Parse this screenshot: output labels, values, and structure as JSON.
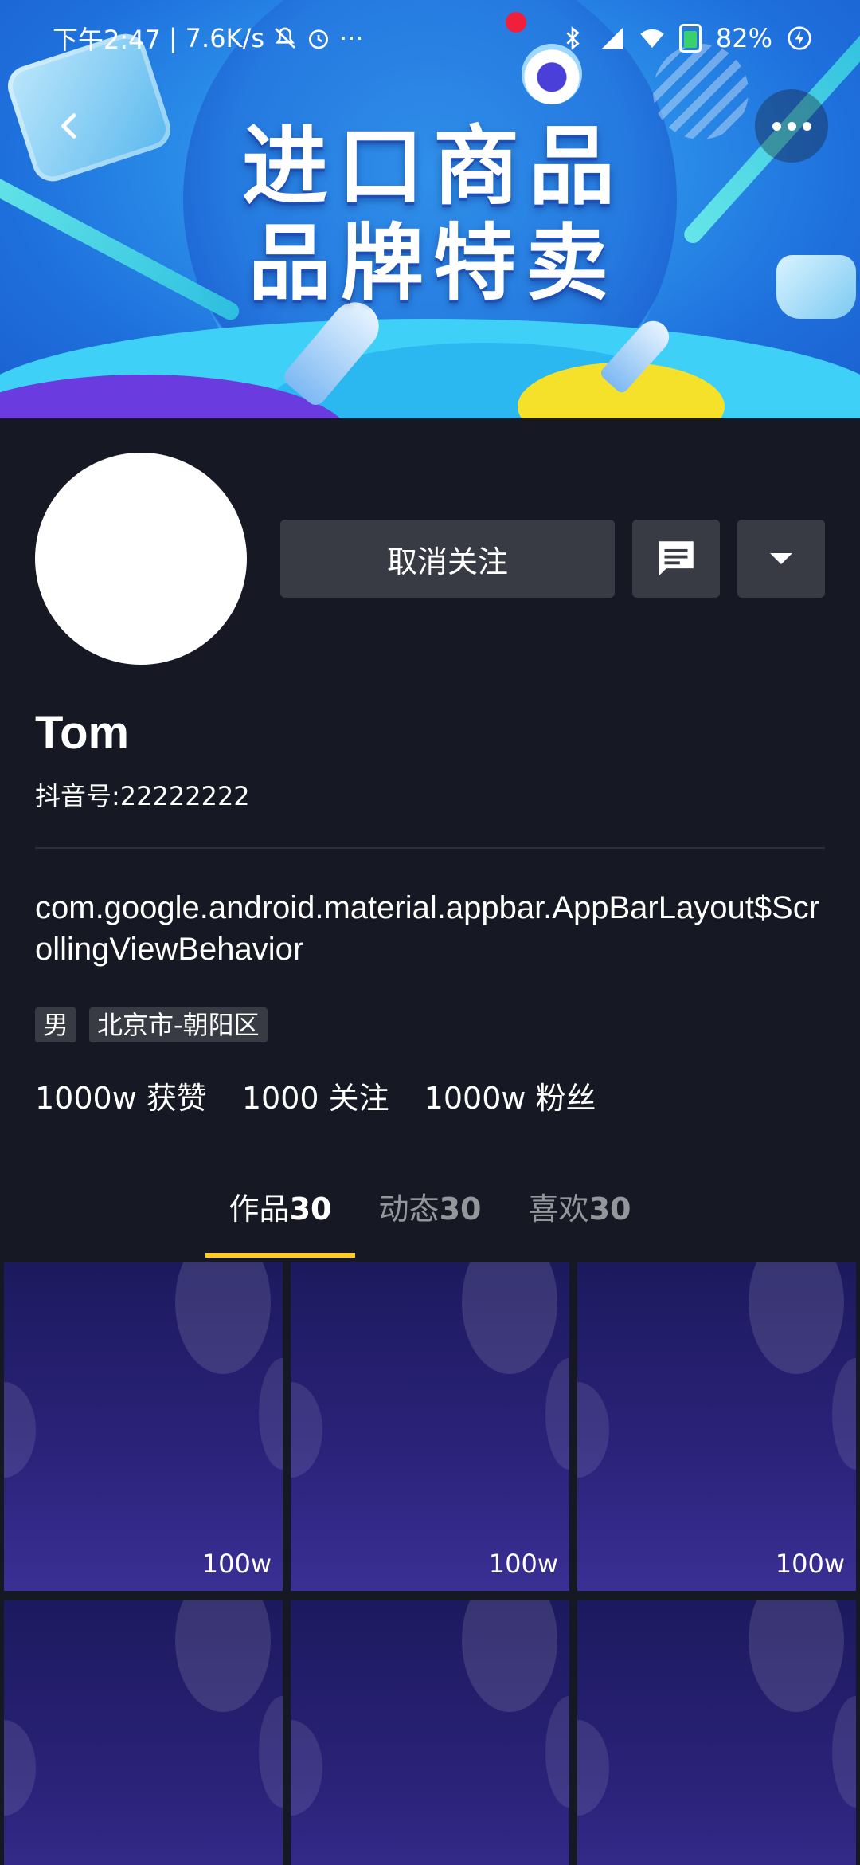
{
  "status_bar": {
    "time": "下午2:47",
    "network_speed": "7.6K/s",
    "battery": "82%"
  },
  "banner": {
    "line1": "进口商品",
    "line2": "品牌特卖"
  },
  "profile": {
    "unfollow_label": "取消关注",
    "name": "Tom",
    "douyin_id": "抖音号:22222222",
    "bio": "com.google.android.material.appbar.AppBarLayout$ScrollingViewBehavior",
    "tags": [
      "男",
      "北京市-朝阳区"
    ],
    "stats": {
      "likes": "1000w 获赞",
      "following": "1000 关注",
      "followers": "1000w 粉丝"
    }
  },
  "tabs": [
    {
      "label": "作品",
      "count": "30",
      "active": true
    },
    {
      "label": "动态",
      "count": "30",
      "active": false
    },
    {
      "label": "喜欢",
      "count": "30",
      "active": false
    }
  ],
  "videos": [
    {
      "views": "100w"
    },
    {
      "views": "100w"
    },
    {
      "views": "100w"
    },
    {
      "views": ""
    },
    {
      "views": ""
    },
    {
      "views": ""
    }
  ],
  "colors": {
    "background": "#161823",
    "button": "#393b44",
    "tab_indicator": "#fcca2b"
  }
}
